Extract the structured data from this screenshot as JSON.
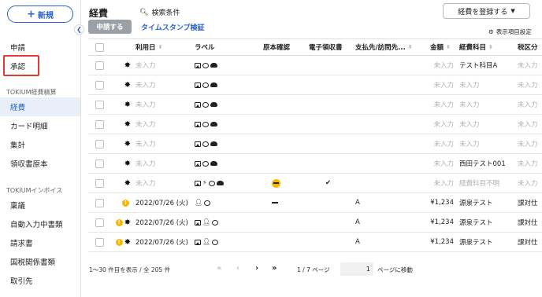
{
  "sidebar": {
    "new_label": "新規",
    "items_top": [
      "申請",
      "承認"
    ],
    "section1": "TOKIUM経費精算",
    "items_section1": [
      "経費",
      "カード明細",
      "集計",
      "領収書原本"
    ],
    "section2": "TOKIUMインボイス",
    "items_section2": [
      "稟議",
      "自動入力中書類",
      "請求書",
      "国税関係書類",
      "取引先"
    ]
  },
  "header": {
    "title": "経費",
    "search": "検索条件",
    "register": "経費を登録する",
    "apply": "申請する",
    "timestamp": "タイムスタンプ検証",
    "display_settings": "表示項目設定"
  },
  "table": {
    "columns": [
      "利用日",
      "ラベル",
      "原本確認",
      "電子領収書",
      "支払先/訪問先...",
      "金額",
      "経費科目",
      "税区分"
    ],
    "rows": [
      {
        "warn": false,
        "date": "未入力",
        "date_muted": true,
        "labels": [
          "img",
          "chat",
          "cloud"
        ],
        "orig": "",
        "erec": "",
        "payee": "",
        "amount": "未入力",
        "amount_muted": true,
        "category": "テスト科目A",
        "cat_muted": false,
        "tax": "未入力"
      },
      {
        "warn": false,
        "date": "未入力",
        "date_muted": true,
        "labels": [
          "img",
          "chat",
          "cloud"
        ],
        "orig": "",
        "erec": "",
        "payee": "",
        "amount": "未入力",
        "amount_muted": true,
        "category": "未入力",
        "cat_muted": true,
        "tax": "未入力"
      },
      {
        "warn": false,
        "date": "未入力",
        "date_muted": true,
        "labels": [
          "img",
          "chat",
          "cloud"
        ],
        "orig": "",
        "erec": "",
        "payee": "",
        "amount": "未入力",
        "amount_muted": true,
        "category": "未入力",
        "cat_muted": true,
        "tax": "未入力"
      },
      {
        "warn": false,
        "date": "未入力",
        "date_muted": true,
        "labels": [
          "img",
          "chat",
          "cloud"
        ],
        "orig": "",
        "erec": "",
        "payee": "",
        "amount": "未入力",
        "amount_muted": true,
        "category": "未入力",
        "cat_muted": true,
        "tax": "未入力"
      },
      {
        "warn": false,
        "date": "未入力",
        "date_muted": true,
        "labels": [
          "img",
          "chat",
          "cloud"
        ],
        "orig": "",
        "erec": "",
        "payee": "",
        "amount": "未入力",
        "amount_muted": true,
        "category": "未入力",
        "cat_muted": true,
        "tax": "未入力"
      },
      {
        "warn": false,
        "date": "未入力",
        "date_muted": true,
        "labels": [
          "img",
          "chat",
          "cloud"
        ],
        "orig": "",
        "erec": "",
        "payee": "",
        "amount": "未入力",
        "amount_muted": true,
        "category": "西田テスト001",
        "cat_muted": false,
        "tax": "未入力"
      },
      {
        "warn": false,
        "date": "未入力",
        "date_muted": true,
        "labels": [
          "img",
          "bolt",
          "chat",
          "cloud"
        ],
        "orig": "minus-badge",
        "erec": "✔",
        "payee": "",
        "amount": "未入力",
        "amount_muted": true,
        "category": "経費科目不明",
        "cat_muted": true,
        "tax": "未入力"
      },
      {
        "warn": true,
        "star": false,
        "date": "2022/07/26 (火)",
        "date_muted": false,
        "labels": [
          "person",
          "chat"
        ],
        "orig": "dash",
        "erec": "",
        "payee": "A",
        "amount": "¥1,234",
        "amount_muted": false,
        "category": "源泉テスト",
        "cat_muted": false,
        "tax": "課対仕"
      },
      {
        "warn": true,
        "date": "2022/07/26 (火)",
        "date_muted": false,
        "labels": [
          "img",
          "person",
          "chat"
        ],
        "orig": "",
        "erec": "",
        "payee": "A",
        "amount": "¥1,234",
        "amount_muted": false,
        "category": "源泉テスト",
        "cat_muted": false,
        "tax": "課対仕"
      },
      {
        "warn": true,
        "date": "2022/07/26 (火)",
        "date_muted": false,
        "labels": [
          "img",
          "person",
          "chat"
        ],
        "orig": "",
        "erec": "",
        "payee": "A",
        "amount": "¥1,234",
        "amount_muted": false,
        "category": "源泉テスト",
        "cat_muted": false,
        "tax": "課対仕"
      }
    ]
  },
  "pager": {
    "info": "1〜30 件目を表示 / 全 205 件",
    "page": "1 / 7 ページ",
    "input": "1",
    "goto": "ページに移動"
  }
}
